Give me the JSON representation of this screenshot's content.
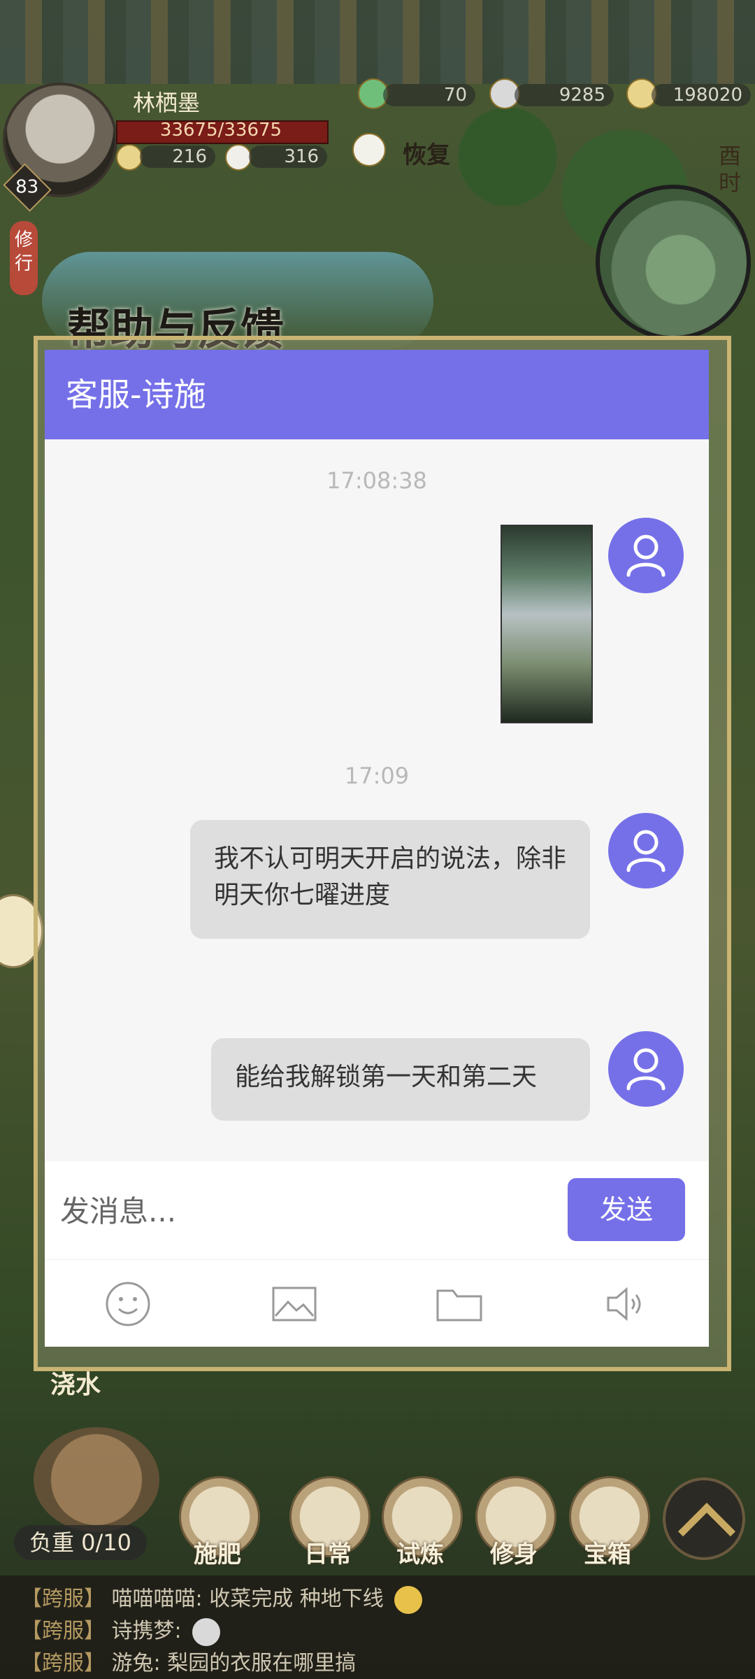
{
  "hud": {
    "player_name": "林栖墨",
    "level": "83",
    "hp": "33675/33675",
    "stat_a": "216",
    "stat_b": "316",
    "recover": "恢复",
    "xiuxing": "修行",
    "currency_1": "70",
    "currency_2": "9285",
    "currency_3": "198020",
    "time_label": "酉时"
  },
  "dialog": {
    "title": "帮助与反馈",
    "header": "客服-诗施",
    "messages": [
      {
        "time": "17:08:38",
        "type": "image"
      },
      {
        "time": "17:09",
        "type": "text",
        "text": "我不认可明天开启的说法，除非明天你七曜进度"
      },
      {
        "type": "text",
        "text": "能给我解锁第一天和第二天"
      }
    ],
    "input_placeholder": "发消息...",
    "send_label": "发送",
    "toolbar_icons": [
      "emoji-icon",
      "image-icon",
      "folder-icon",
      "speaker-icon"
    ]
  },
  "bottom": {
    "weight": "负重 0/10",
    "jiaoshui": "浇水",
    "buttons": [
      "施肥",
      "日常",
      "试炼",
      "修身",
      "宝箱"
    ]
  },
  "chat_log": [
    {
      "tag": "【跨服】",
      "text": "喵喵喵喵: 收菜完成 种地下线"
    },
    {
      "tag": "【跨服】",
      "text": "诗携梦:"
    },
    {
      "tag": "【跨服】",
      "text": "游兔: 梨园的衣服在哪里搞"
    }
  ],
  "colors": {
    "accent": "#7570e8",
    "bubble": "#dedede"
  }
}
